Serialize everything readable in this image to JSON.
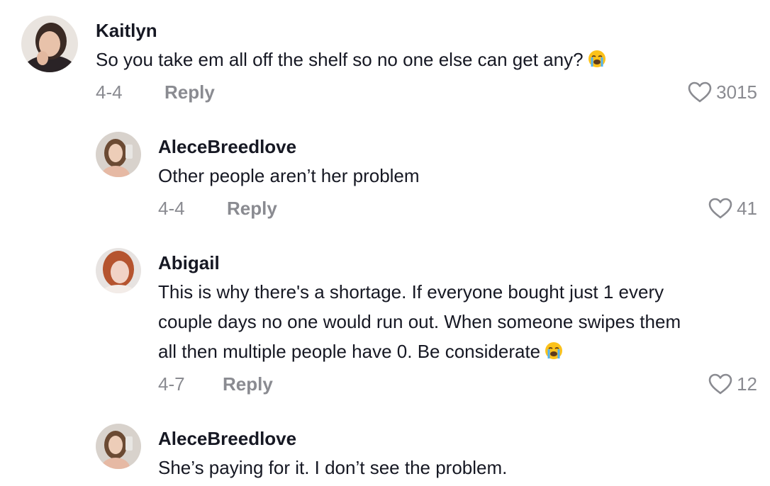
{
  "comments": [
    {
      "username": "Kaitlyn",
      "text": "So you take em all off the shelf so no one else can get any?",
      "emoji": "loudly-crying-face",
      "date": "4-4",
      "reply_label": "Reply",
      "likes": "3015"
    },
    {
      "username": "AleceBreedlove",
      "text": "Other people aren’t her problem",
      "date": "4-4",
      "reply_label": "Reply",
      "likes": "41"
    },
    {
      "username": "Abigail",
      "lines": [
        "This is why there's a shortage. If everyone bought just 1 every",
        "couple days no one would run out. When someone swipes them",
        "all then multiple people have 0. Be considerate"
      ],
      "emoji": "loudly-crying-face",
      "date": "4-7",
      "reply_label": "Reply",
      "likes": "12"
    },
    {
      "username": "AleceBreedlove",
      "text": "She’s paying for it. I don’t see the problem."
    }
  ],
  "colors": {
    "primary_text": "#161823",
    "secondary_text": "#8a8b91",
    "background": "#ffffff"
  },
  "icons": {
    "like": "heart-outline-icon",
    "emoji": "loudly-crying-face-emoji"
  }
}
